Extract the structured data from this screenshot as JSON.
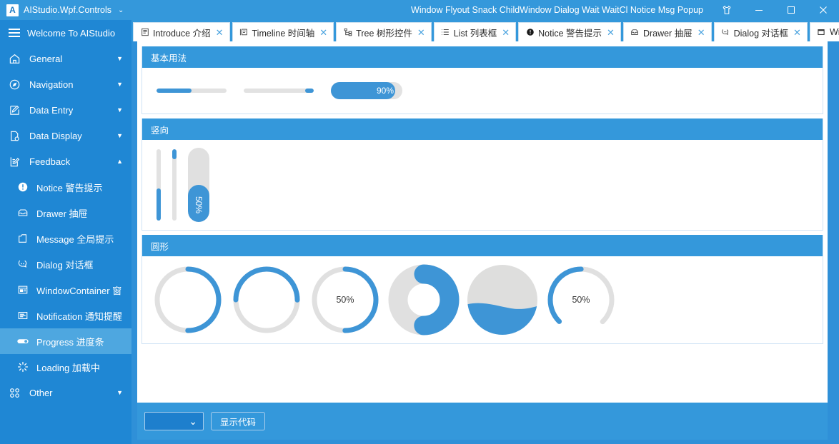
{
  "window": {
    "brand_logo": "A",
    "brand_title": "AIStudio.Wpf.Controls",
    "brand_caret": "⌄",
    "title_text": "Window Flyout Snack ChildWindow Dialog Wait WaitCl Notice Msg Popup",
    "theme_icon": "shirt-icon",
    "minimize_label": "─",
    "maximize_label": "☐",
    "close_label": "✕"
  },
  "sidebar": {
    "header_label": "Welcome To AIStudio",
    "groups": [
      {
        "icon": "home-icon",
        "label": "General",
        "caret": "▼",
        "expanded": false
      },
      {
        "icon": "compass-icon",
        "label": "Navigation",
        "caret": "▼",
        "expanded": false
      },
      {
        "icon": "edit-box-icon",
        "label": "Data Entry",
        "caret": "▼",
        "expanded": false
      },
      {
        "icon": "doc-search-icon",
        "label": "Data Display",
        "caret": "▼",
        "expanded": false
      },
      {
        "icon": "feedback-icon",
        "label": "Feedback",
        "caret": "▲",
        "expanded": true
      }
    ],
    "items": [
      {
        "icon": "exclamation-circle-icon",
        "label": "Notice 警告提示",
        "selected": false
      },
      {
        "icon": "drawer-icon",
        "label": "Drawer 抽屉",
        "selected": false
      },
      {
        "icon": "message-icon",
        "label": "Message 全局提示",
        "selected": false
      },
      {
        "icon": "dialog-icon",
        "label": "Dialog 对话框",
        "selected": false
      },
      {
        "icon": "window-container-icon",
        "label": "WindowContainer 窗",
        "selected": false
      },
      {
        "icon": "notification-icon",
        "label": "Notification 通知提醒",
        "selected": false
      },
      {
        "icon": "progress-icon",
        "label": "Progress 进度条",
        "selected": true
      },
      {
        "icon": "loading-icon",
        "label": "Loading 加载中",
        "selected": false
      }
    ],
    "other_group": {
      "icon": "grid-icon",
      "label": "Other",
      "caret": "▼"
    }
  },
  "tabs": [
    {
      "icon": "book-icon",
      "label": "Introduce 介绍",
      "close": "✕",
      "active": true,
      "caret": ""
    },
    {
      "icon": "timeline-icon",
      "label": "Timeline 时间轴",
      "close": "✕",
      "active": false,
      "caret": ""
    },
    {
      "icon": "tree-icon",
      "label": "Tree 树形控件",
      "close": "✕",
      "active": false,
      "caret": ""
    },
    {
      "icon": "list-icon",
      "label": "List 列表框",
      "close": "✕",
      "active": false,
      "caret": ""
    },
    {
      "icon": "notice-icon",
      "label": "Notice 警告提示",
      "close": "✕",
      "active": false,
      "caret": ""
    },
    {
      "icon": "drawer-icon",
      "label": "Drawer 抽屉",
      "close": "✕",
      "active": false,
      "caret": ""
    },
    {
      "icon": "dialog-icon",
      "label": "Dialog 对话框",
      "close": "✕",
      "active": false,
      "caret": ""
    },
    {
      "icon": "window-icon",
      "label": "Wi",
      "close": "",
      "active": false,
      "caret": "⌄"
    }
  ],
  "panels": {
    "basic": {
      "title": "基本用法",
      "bars": [
        {
          "name": "progress-bar-1",
          "value": 50,
          "style": "thin",
          "direction": "ltr",
          "show_label": false
        },
        {
          "name": "progress-bar-2",
          "value": 12,
          "style": "thin",
          "direction": "rtl",
          "show_label": false
        },
        {
          "name": "progress-bar-3",
          "value": 90,
          "style": "thick",
          "direction": "ltr",
          "show_label": true,
          "label": "90%"
        }
      ]
    },
    "vertical": {
      "title": "竖向",
      "bars": [
        {
          "name": "vertical-bar-1",
          "value": 45,
          "style": "thin",
          "fill_from": "bottom",
          "show_label": false
        },
        {
          "name": "vertical-bar-2",
          "value": 14,
          "style": "thin",
          "fill_from": "top",
          "show_label": false
        },
        {
          "name": "vertical-bar-3",
          "value": 50,
          "style": "thick",
          "fill_from": "bottom",
          "show_label": true,
          "label": "50%"
        }
      ]
    },
    "circular": {
      "title": "圆形",
      "items": [
        {
          "name": "circle-progress-1",
          "value": 50,
          "variant": "ring-thin",
          "start_angle": -90,
          "label": "",
          "show_label": false,
          "thickness": 7
        },
        {
          "name": "circle-progress-2",
          "value": 50,
          "variant": "ring-thin",
          "start_angle": 180,
          "label": "",
          "show_label": false,
          "thickness": 7
        },
        {
          "name": "circle-progress-3",
          "value": 50,
          "variant": "ring-thin",
          "start_angle": -90,
          "label": "50%",
          "show_label": true,
          "thickness": 7
        },
        {
          "name": "circle-progress-4",
          "value": 50,
          "variant": "ring-thick",
          "start_angle": -90,
          "label": "",
          "show_label": false,
          "thickness": 26
        },
        {
          "name": "circle-progress-5",
          "value": 45,
          "variant": "wave",
          "start_angle": 0,
          "label": "",
          "show_label": false,
          "thickness": 0
        },
        {
          "name": "circle-progress-6",
          "value": 50,
          "variant": "gauge",
          "start_angle": 135,
          "label": "50%",
          "show_label": true,
          "thickness": 7
        }
      ]
    }
  },
  "footer": {
    "combo_value": "",
    "combo_caret": "⌄",
    "show_code_label": "显示代码"
  },
  "colors": {
    "accent": "#3498db",
    "sidebar": "#1f87d4",
    "sidebar_selected": "#4ea7e0",
    "track": "#e2e2e2",
    "fill": "#3e95d6",
    "panel_border": "#cfe3f5"
  }
}
